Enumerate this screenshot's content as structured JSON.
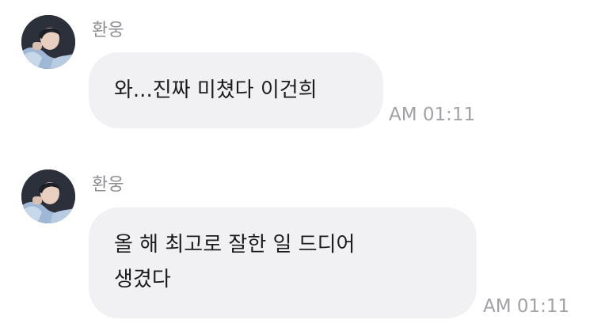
{
  "messages": [
    {
      "sender": "환웅",
      "text": "와...진짜 미쳤다 이건희",
      "time": "AM 01:11"
    },
    {
      "sender": "환웅",
      "text": "올 해 최고로 잘한 일 드디어\n생겼다",
      "time": "AM 01:11"
    }
  ]
}
